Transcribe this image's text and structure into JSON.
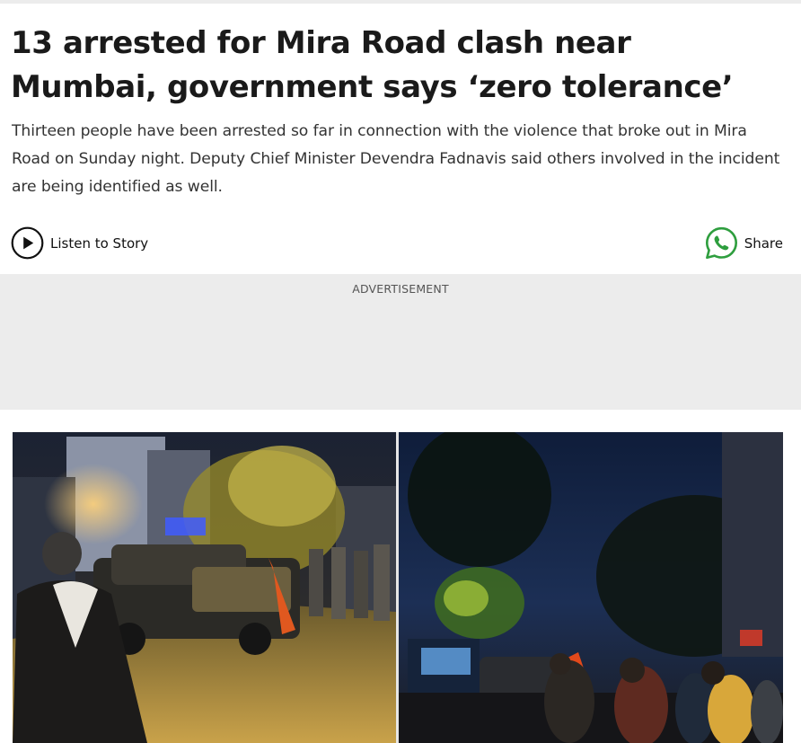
{
  "article": {
    "headline": "13 arrested for Mira Road clash near Mumbai, government says ‘zero tolerance’",
    "summary": "Thirteen people have been arrested so far in connection with the violence that broke out in Mira Road on Sunday night. Deputy Chief Minister Devendra Fadnavis said others involved in the incident are being identified as well."
  },
  "actions": {
    "listen_label": "Listen to Story",
    "listen_icon": "play-circle-icon",
    "share_label": "Share",
    "share_icon": "whatsapp-icon"
  },
  "ad": {
    "label": "ADVERTISEMENT"
  },
  "colors": {
    "whatsapp_green": "#2e9e3e",
    "ad_background": "#ececec"
  }
}
